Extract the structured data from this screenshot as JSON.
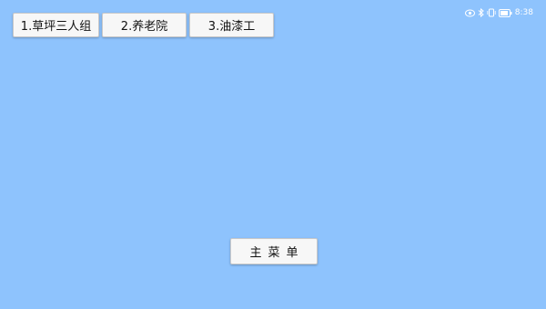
{
  "tabs": [
    {
      "label": "1.草坪三人组"
    },
    {
      "label": "2.养老院"
    },
    {
      "label": "3.油漆工"
    }
  ],
  "status": {
    "time": "8:38",
    "icons": [
      "eye-icon",
      "bluetooth-icon",
      "vibrate-icon",
      "battery-icon"
    ]
  },
  "main_menu": {
    "label": "主菜单"
  },
  "colors": {
    "background": "#8ec3fd",
    "button": "#f7f7f7"
  }
}
